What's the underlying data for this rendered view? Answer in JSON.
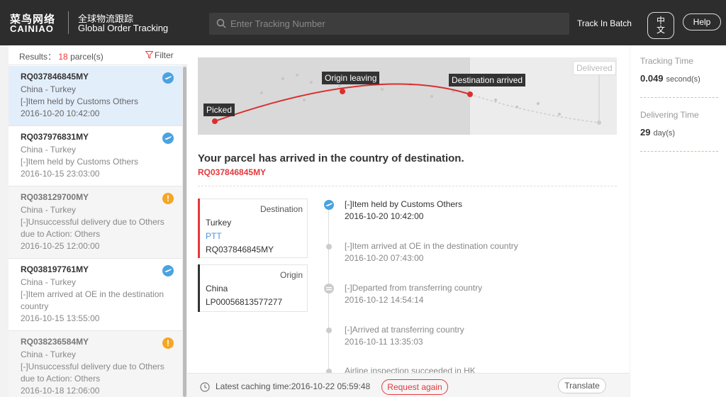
{
  "header": {
    "logo_cn": "菜鸟网络",
    "logo_en": "CAINIAO",
    "subtitle_cn": "全球物流跟踪",
    "subtitle_en": "Global Order Tracking",
    "search_placeholder": "Enter Tracking Number",
    "batch_label": "Track In Batch",
    "lang_line1": "中",
    "lang_line2": "文",
    "help_label": "Help"
  },
  "sidebar": {
    "results_label": "Results：",
    "results_count": "18",
    "results_unit": "parcel(s)",
    "filter_label": "Filter",
    "parcels": [
      {
        "id": "RQ037846845MY",
        "route": "China - Turkey",
        "status": "[-]Item held by Customs Others",
        "status2": "",
        "time": "2016-10-20 10:42:00",
        "icon": "plane-icon"
      },
      {
        "id": "RQ037976831MY",
        "route": "China - Turkey",
        "status": "[-]Item held by Customs Others",
        "status2": "",
        "time": "2016-10-15 23:03:00",
        "icon": "plane-icon"
      },
      {
        "id": "RQ038129700MY",
        "route": "China - Turkey",
        "status": "[-]Unsuccessful delivery due to Others",
        "status2": "due to Action: Others",
        "time": "2016-10-25 12:00:00",
        "icon": "warning-icon"
      },
      {
        "id": "RQ038197761MY",
        "route": "China - Turkey",
        "status": "[-]Item arrived at OE in the destination",
        "status2": "country",
        "time": "2016-10-15 13:55:00",
        "icon": "plane-icon"
      },
      {
        "id": "RQ038236584MY",
        "route": "China - Turkey",
        "status": "[-]Unsuccessful delivery due to Others",
        "status2": "due to Action: Others",
        "time": "2016-10-18 12:06:00",
        "icon": "warning-icon"
      }
    ]
  },
  "map": {
    "picked": "Picked",
    "origin_leaving": "Origin leaving",
    "destination_arrived": "Destination arrived",
    "delivered": "Delivered"
  },
  "detail": {
    "title": "Your parcel has arrived in the country of destination.",
    "tracking_id": "RQ037846845MY",
    "destination": {
      "label": "Destination",
      "country": "Turkey",
      "carrier": "PTT",
      "number": "RQ037846845MY"
    },
    "origin": {
      "label": "Origin",
      "country": "China",
      "number": "LP00056813577277"
    },
    "events": [
      {
        "text": "[-]Item held by Customs Others",
        "time": "2016-10-20 10:42:00"
      },
      {
        "text": "[-]Item arrived at OE in the destination country",
        "time": "2016-10-20 07:43:00"
      },
      {
        "text": "[-]Departed from transferring country",
        "time": "2016-10-12 14:54:14"
      },
      {
        "text": "[-]Arrived at transferring country",
        "time": "2016-10-11 13:35:03"
      },
      {
        "text": "Airline inspection succeeded in HK",
        "time": ""
      }
    ],
    "cache_label": "Latest caching time:2016-10-22 05:59:48",
    "request_again": "Request again",
    "translate": "Translate"
  },
  "stats": {
    "tracking_time_label": "Tracking Time",
    "tracking_time_value": "0.049",
    "tracking_time_unit": "second(s)",
    "delivering_time_label": "Delivering Time",
    "delivering_time_value": "29",
    "delivering_time_unit": "day(s)"
  },
  "colors": {
    "accent_red": "#e4393c",
    "plane_blue": "#4aa3df",
    "warning_orange": "#f5a623",
    "header_bg": "#2d2d2d"
  }
}
